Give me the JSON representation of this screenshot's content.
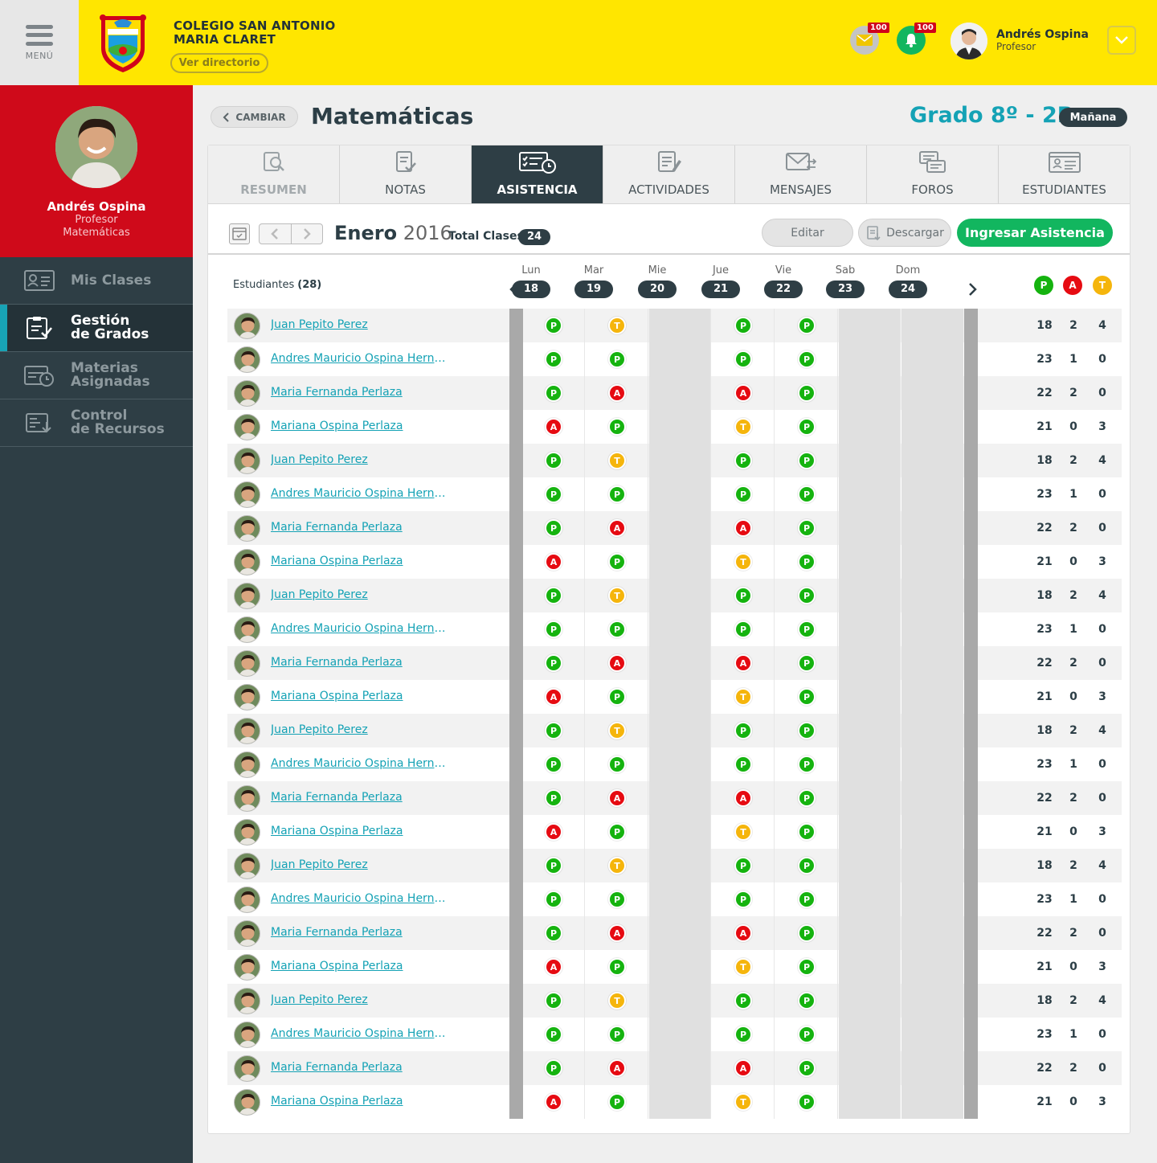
{
  "header": {
    "menu_label": "MENÚ",
    "school_line1": "COLEGIO SAN ANTONIO",
    "school_line2": "MARIA CLARET",
    "directory_button": "Ver directorio",
    "messages_count": "100",
    "notifications_count": "100",
    "user_name": "Andrés Ospina",
    "user_role": "Profesor",
    "colors": {
      "bar": "#ffe600",
      "badge": "#d0021b"
    }
  },
  "sidebar": {
    "profile_name": "Andrés Ospina",
    "profile_role": "Profesor",
    "profile_subject": "Matemáticas",
    "items": [
      {
        "label": "Mis Clases",
        "icon": "id-card-icon",
        "active": false
      },
      {
        "label": "Gestión\nde Grados",
        "icon": "clipboard-check-icon",
        "active": true
      },
      {
        "label": "Materias\nAsignadas",
        "icon": "calendar-clock-icon",
        "active": false
      },
      {
        "label": "Control\nde Recursos",
        "icon": "resources-icon",
        "active": false
      }
    ]
  },
  "page": {
    "back_button": "CAMBIAR",
    "subject": "Matemáticas",
    "grade": "Grado 8º - 2B",
    "shift": "Mañana"
  },
  "tabs": [
    {
      "label": "RESUMEN",
      "icon": "search-doc-icon"
    },
    {
      "label": "NOTAS",
      "icon": "notes-check-icon"
    },
    {
      "label": "ASISTENCIA",
      "icon": "attendance-icon"
    },
    {
      "label": "ACTIVIDADES",
      "icon": "activities-icon"
    },
    {
      "label": "MENSAJES",
      "icon": "envelope-icon"
    },
    {
      "label": "FOROS",
      "icon": "forum-icon"
    },
    {
      "label": "ESTUDIANTES",
      "icon": "students-card-icon"
    }
  ],
  "toolbar": {
    "month": "Enero",
    "year": "2016",
    "total_label": "Total Clases",
    "total_value": "24",
    "edit_button": "Editar",
    "download_button": "Descargar",
    "enter_button": "Ingresar Asistencia"
  },
  "grid": {
    "students_label": "Estudiantes",
    "students_count": "(28)",
    "days": [
      {
        "name": "Lun",
        "date": "18"
      },
      {
        "name": "Mar",
        "date": "19"
      },
      {
        "name": "Mie",
        "date": "20"
      },
      {
        "name": "Jue",
        "date": "21"
      },
      {
        "name": "Vie",
        "date": "22"
      },
      {
        "name": "Sab",
        "date": "23"
      },
      {
        "name": "Dom",
        "date": "24"
      }
    ],
    "summary_labels": [
      "P",
      "A",
      "T"
    ],
    "status_colors": {
      "P": "#15b30f",
      "A": "#e60b12",
      "T": "#f5b50c"
    },
    "rows": [
      {
        "name": "Juan Pepito Perez ",
        "marks": [
          "P",
          "T",
          "",
          "P",
          "P",
          "",
          ""
        ],
        "totals": [
          "18",
          "2",
          "4"
        ]
      },
      {
        "name": "Andres Mauricio Ospina Hernan...",
        "marks": [
          "P",
          "P",
          "",
          "P",
          "P",
          "",
          ""
        ],
        "totals": [
          "23",
          "1",
          "0"
        ]
      },
      {
        "name": "Maria Fernanda Perlaza",
        "marks": [
          "P",
          "A",
          "",
          "A",
          "P",
          "",
          ""
        ],
        "totals": [
          "22",
          "2",
          "0"
        ]
      },
      {
        "name": "Mariana Ospina Perlaza",
        "marks": [
          "A",
          "P",
          "",
          "T",
          "P",
          "",
          ""
        ],
        "totals": [
          "21",
          "0",
          "3"
        ]
      },
      {
        "name": "Juan Pepito Perez ",
        "marks": [
          "P",
          "T",
          "",
          "P",
          "P",
          "",
          ""
        ],
        "totals": [
          "18",
          "2",
          "4"
        ]
      },
      {
        "name": "Andres Mauricio Ospina Hernan...",
        "marks": [
          "P",
          "P",
          "",
          "P",
          "P",
          "",
          ""
        ],
        "totals": [
          "23",
          "1",
          "0"
        ]
      },
      {
        "name": "Maria Fernanda Perlaza",
        "marks": [
          "P",
          "A",
          "",
          "A",
          "P",
          "",
          ""
        ],
        "totals": [
          "22",
          "2",
          "0"
        ]
      },
      {
        "name": "Mariana Ospina Perlaza",
        "marks": [
          "A",
          "P",
          "",
          "T",
          "P",
          "",
          ""
        ],
        "totals": [
          "21",
          "0",
          "3"
        ]
      },
      {
        "name": "Juan Pepito Perez ",
        "marks": [
          "P",
          "T",
          "",
          "P",
          "P",
          "",
          ""
        ],
        "totals": [
          "18",
          "2",
          "4"
        ]
      },
      {
        "name": "Andres Mauricio Ospina Hernan...",
        "marks": [
          "P",
          "P",
          "",
          "P",
          "P",
          "",
          ""
        ],
        "totals": [
          "23",
          "1",
          "0"
        ]
      },
      {
        "name": "Maria Fernanda Perlaza",
        "marks": [
          "P",
          "A",
          "",
          "A",
          "P",
          "",
          ""
        ],
        "totals": [
          "22",
          "2",
          "0"
        ]
      },
      {
        "name": "Mariana Ospina Perlaza",
        "marks": [
          "A",
          "P",
          "",
          "T",
          "P",
          "",
          ""
        ],
        "totals": [
          "21",
          "0",
          "3"
        ]
      },
      {
        "name": "Juan Pepito Perez ",
        "marks": [
          "P",
          "T",
          "",
          "P",
          "P",
          "",
          ""
        ],
        "totals": [
          "18",
          "2",
          "4"
        ]
      },
      {
        "name": "Andres Mauricio Ospina Hernan...",
        "marks": [
          "P",
          "P",
          "",
          "P",
          "P",
          "",
          ""
        ],
        "totals": [
          "23",
          "1",
          "0"
        ]
      },
      {
        "name": "Maria Fernanda Perlaza",
        "marks": [
          "P",
          "A",
          "",
          "A",
          "P",
          "",
          ""
        ],
        "totals": [
          "22",
          "2",
          "0"
        ]
      },
      {
        "name": "Mariana Ospina Perlaza",
        "marks": [
          "A",
          "P",
          "",
          "T",
          "P",
          "",
          ""
        ],
        "totals": [
          "21",
          "0",
          "3"
        ]
      },
      {
        "name": "Juan Pepito Perez ",
        "marks": [
          "P",
          "T",
          "",
          "P",
          "P",
          "",
          ""
        ],
        "totals": [
          "18",
          "2",
          "4"
        ]
      },
      {
        "name": "Andres Mauricio Ospina Hernan...",
        "marks": [
          "P",
          "P",
          "",
          "P",
          "P",
          "",
          ""
        ],
        "totals": [
          "23",
          "1",
          "0"
        ]
      },
      {
        "name": "Maria Fernanda Perlaza",
        "marks": [
          "P",
          "A",
          "",
          "A",
          "P",
          "",
          ""
        ],
        "totals": [
          "22",
          "2",
          "0"
        ]
      },
      {
        "name": "Mariana Ospina Perlaza",
        "marks": [
          "A",
          "P",
          "",
          "T",
          "P",
          "",
          ""
        ],
        "totals": [
          "21",
          "0",
          "3"
        ]
      },
      {
        "name": "Juan Pepito Perez ",
        "marks": [
          "P",
          "T",
          "",
          "P",
          "P",
          "",
          ""
        ],
        "totals": [
          "18",
          "2",
          "4"
        ]
      },
      {
        "name": "Andres Mauricio Ospina Hernan...",
        "marks": [
          "P",
          "P",
          "",
          "P",
          "P",
          "",
          ""
        ],
        "totals": [
          "23",
          "1",
          "0"
        ]
      },
      {
        "name": "Maria Fernanda Perlaza",
        "marks": [
          "P",
          "A",
          "",
          "A",
          "P",
          "",
          ""
        ],
        "totals": [
          "22",
          "2",
          "0"
        ]
      },
      {
        "name": "Mariana Ospina Perlaza",
        "marks": [
          "A",
          "P",
          "",
          "T",
          "P",
          "",
          ""
        ],
        "totals": [
          "21",
          "0",
          "3"
        ]
      }
    ]
  }
}
